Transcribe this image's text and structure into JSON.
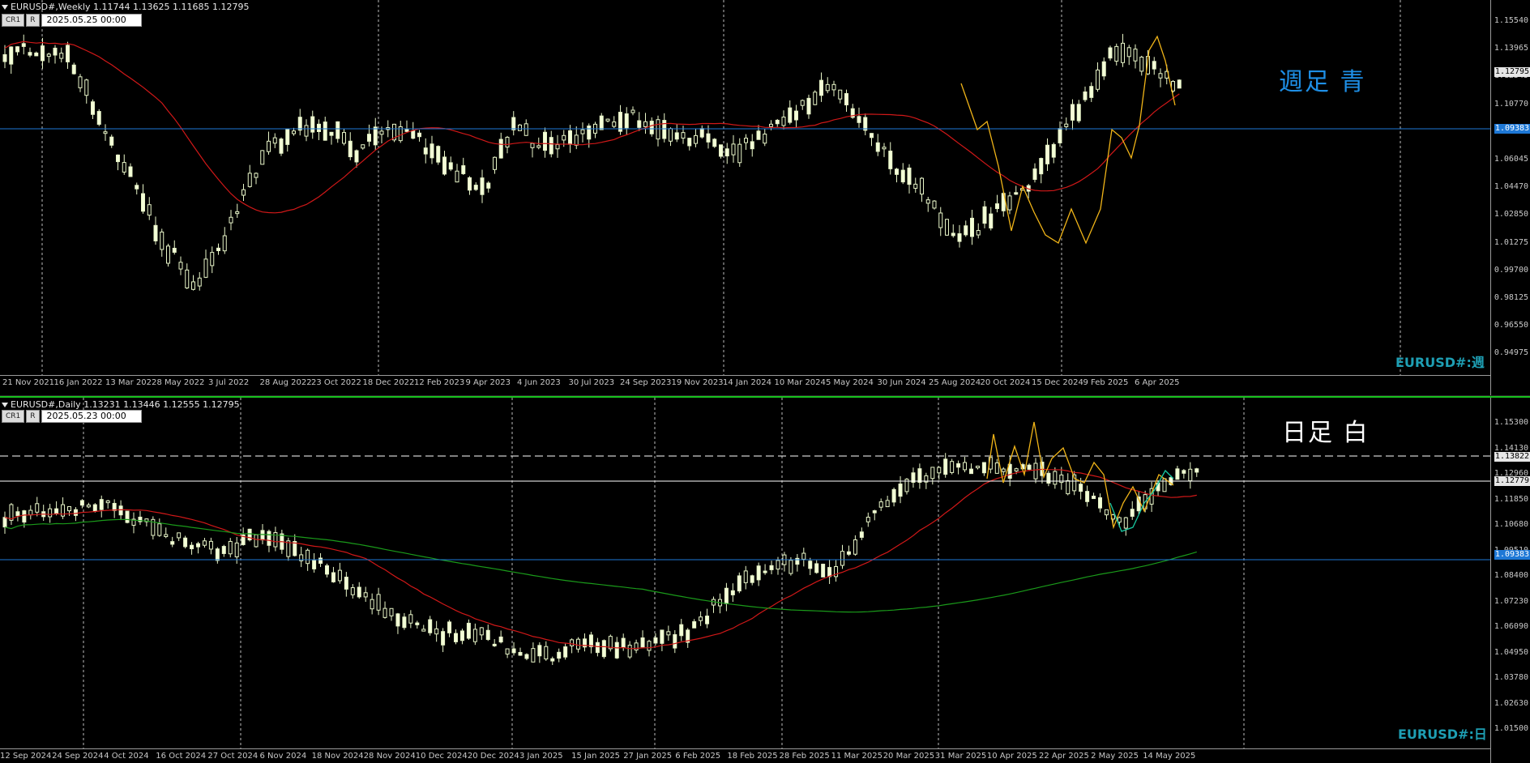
{
  "weekly": {
    "symbol_line": "EURUSD#,Weekly  1.11744 1.13625 1.11685 1.12795",
    "btn_cr": "CR1",
    "btn_r": "R",
    "date_field": "2025.05.25 00:00",
    "big_label": "週足  青",
    "symbol_label": "EURUSD#:週",
    "price_ticks": [
      "1.15540",
      "1.13965",
      "1.12345",
      "1.10770",
      "1.07620",
      "1.06045",
      "1.04470",
      "1.02850",
      "1.01275",
      "0.99700",
      "0.98125",
      "0.96550",
      "0.94975"
    ],
    "current_price": "1.12795",
    "blue_line_price": "1.09383",
    "time_labels": [
      "21 Nov 2021",
      "16 Jan 2022",
      "13 Mar 2022",
      "8 May 2022",
      "3 Jul 2022",
      "28 Aug 2022",
      "23 Oct 2022",
      "18 Dec 2022",
      "12 Feb 2023",
      "9 Apr 2023",
      "4 Jun 2023",
      "30 Jul 2023",
      "24 Sep 2023",
      "19 Nov 2023",
      "14 Jan 2024",
      "10 Mar 2024",
      "5 May 2024",
      "30 Jun 2024",
      "25 Aug 2024",
      "20 Oct 2024",
      "15 Dec 2024",
      "9 Feb 2025",
      "6 Apr 2025"
    ],
    "colors": {
      "blue_line": "#1e78d6",
      "ma": "#d01818",
      "zigzag": "#f0b418",
      "label": "#1e8fe6"
    }
  },
  "daily": {
    "symbol_line": "EURUSD#,Daily  1.13231 1.13446 1.12555 1.12795",
    "btn_cr": "CR1",
    "btn_r": "R",
    "date_field": "2025.05.23 00:00",
    "big_label": "日足  白",
    "symbol_label": "EURUSD#:日",
    "price_ticks": [
      "1.15300",
      "1.14130",
      "1.12960",
      "1.11850",
      "1.10680",
      "1.09510",
      "1.08400",
      "1.07230",
      "1.06090",
      "1.04950",
      "1.03780",
      "1.02630",
      "1.01500"
    ],
    "current_price": "1.12779",
    "dashed_line_price": "1.13822",
    "blue_line_price": "1.09383",
    "time_labels": [
      "12 Sep 2024",
      "24 Sep 2024",
      "4 Oct 2024",
      "16 Oct 2024",
      "27 Oct 2024",
      "6 Nov 2024",
      "18 Nov 2024",
      "28 Nov 2024",
      "10 Dec 2024",
      "20 Dec 2024",
      "3 Jan 2025",
      "15 Jan 2025",
      "27 Jan 2025",
      "6 Feb 2025",
      "18 Feb 2025",
      "28 Feb 2025",
      "11 Mar 2025",
      "20 Mar 2025",
      "31 Mar 2025",
      "10 Apr 2025",
      "22 Apr 2025",
      "2 May 2025",
      "14 May 2025"
    ],
    "colors": {
      "blue_line": "#1e78d6",
      "ma_fast": "#d01818",
      "ma_slow": "#1a9a1a",
      "zigzag": "#f0b418",
      "zigzag2": "#18c8a0"
    }
  }
}
